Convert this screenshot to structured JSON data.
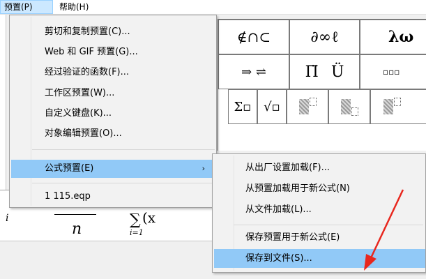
{
  "menubar": {
    "items": [
      {
        "label": "预置(P)"
      },
      {
        "label": "帮助(H)"
      }
    ]
  },
  "palette": {
    "row1": [
      "∉∩⊂",
      "∂∞ℓ",
      "λω"
    ],
    "row2_arrows": "⇒ ⇌",
    "row2_prod": "Π̈",
    "row2_U": "Ü",
    "row2_boxes": "▫▫▫",
    "row3_sum": "Σ▫",
    "row3_sqrt": "√▫"
  },
  "formula": {
    "denominator": "n",
    "left_var": "i",
    "sum_symbol": "∑",
    "sum_lower": "i=1",
    "sum_body": "(x",
    "sum_sub": "i"
  },
  "menu_main": {
    "items": [
      {
        "label": "剪切和复制预置(C)..."
      },
      {
        "label": "Web 和 GIF 预置(G)..."
      },
      {
        "label": "经过验证的函数(F)..."
      },
      {
        "label": "工作区预置(W)..."
      },
      {
        "label": "自定义键盘(K)..."
      },
      {
        "label": "对象编辑预置(O)..."
      },
      {
        "label": "公式预置(E)",
        "arrow": "›"
      },
      {
        "label": "1 115.eqp"
      }
    ]
  },
  "menu_sub": {
    "items": [
      {
        "label": "从出厂设置加载(F)..."
      },
      {
        "label": "从预置加载用于新公式(N)"
      },
      {
        "label": "从文件加载(L)..."
      },
      {
        "label": "保存预置用于新公式(E)"
      },
      {
        "label": "保存到文件(S)..."
      }
    ]
  },
  "colors": {
    "highlight": "#91c9f7",
    "annotation_arrow": "#e8271e"
  }
}
